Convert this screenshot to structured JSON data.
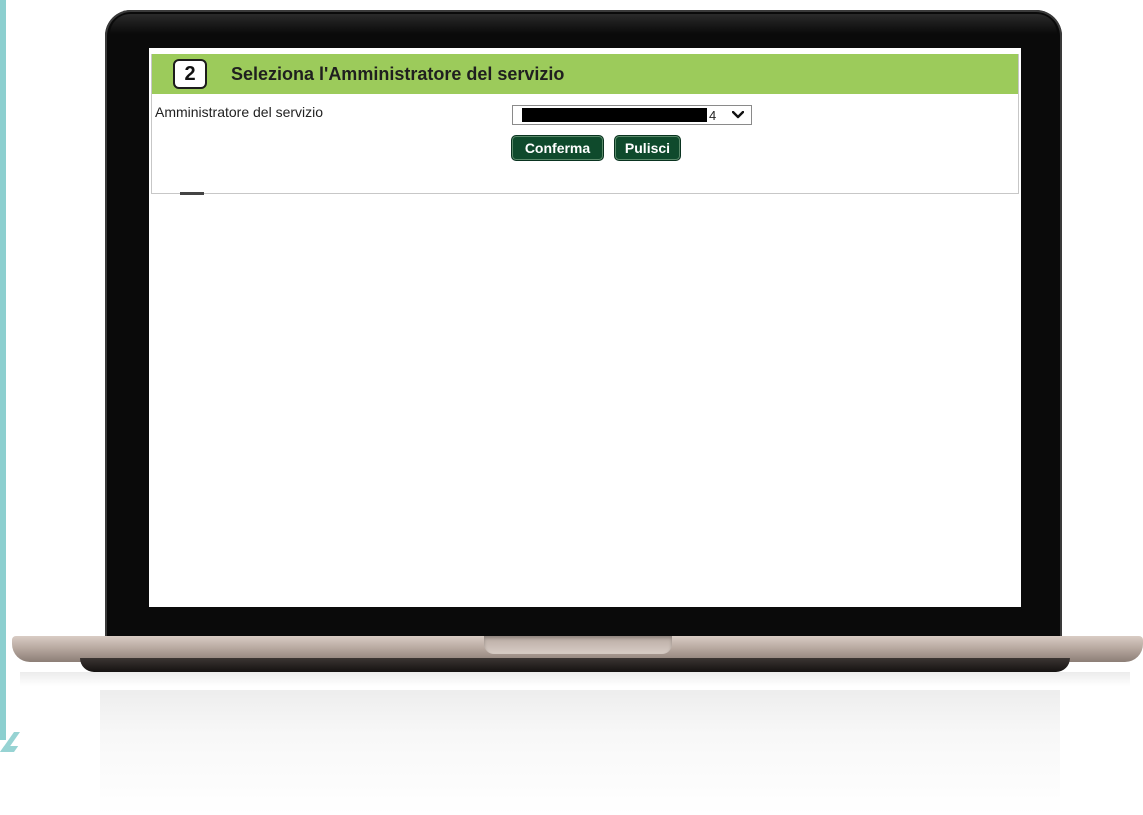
{
  "step": {
    "number": "2",
    "title": "Seleziona l'Amministratore del servizio"
  },
  "form": {
    "field_label": "Amministratore del servizio",
    "select_value_suffix": "4"
  },
  "buttons": {
    "confirm_label": "Conferma",
    "clear_label": "Pulisci"
  },
  "colors": {
    "header_green": "#9ccb5b",
    "button_dark_green": "#0f4a2c",
    "accent_teal": "#8ccfcf"
  },
  "icons": {
    "dropdown": "chevron-down-icon"
  }
}
